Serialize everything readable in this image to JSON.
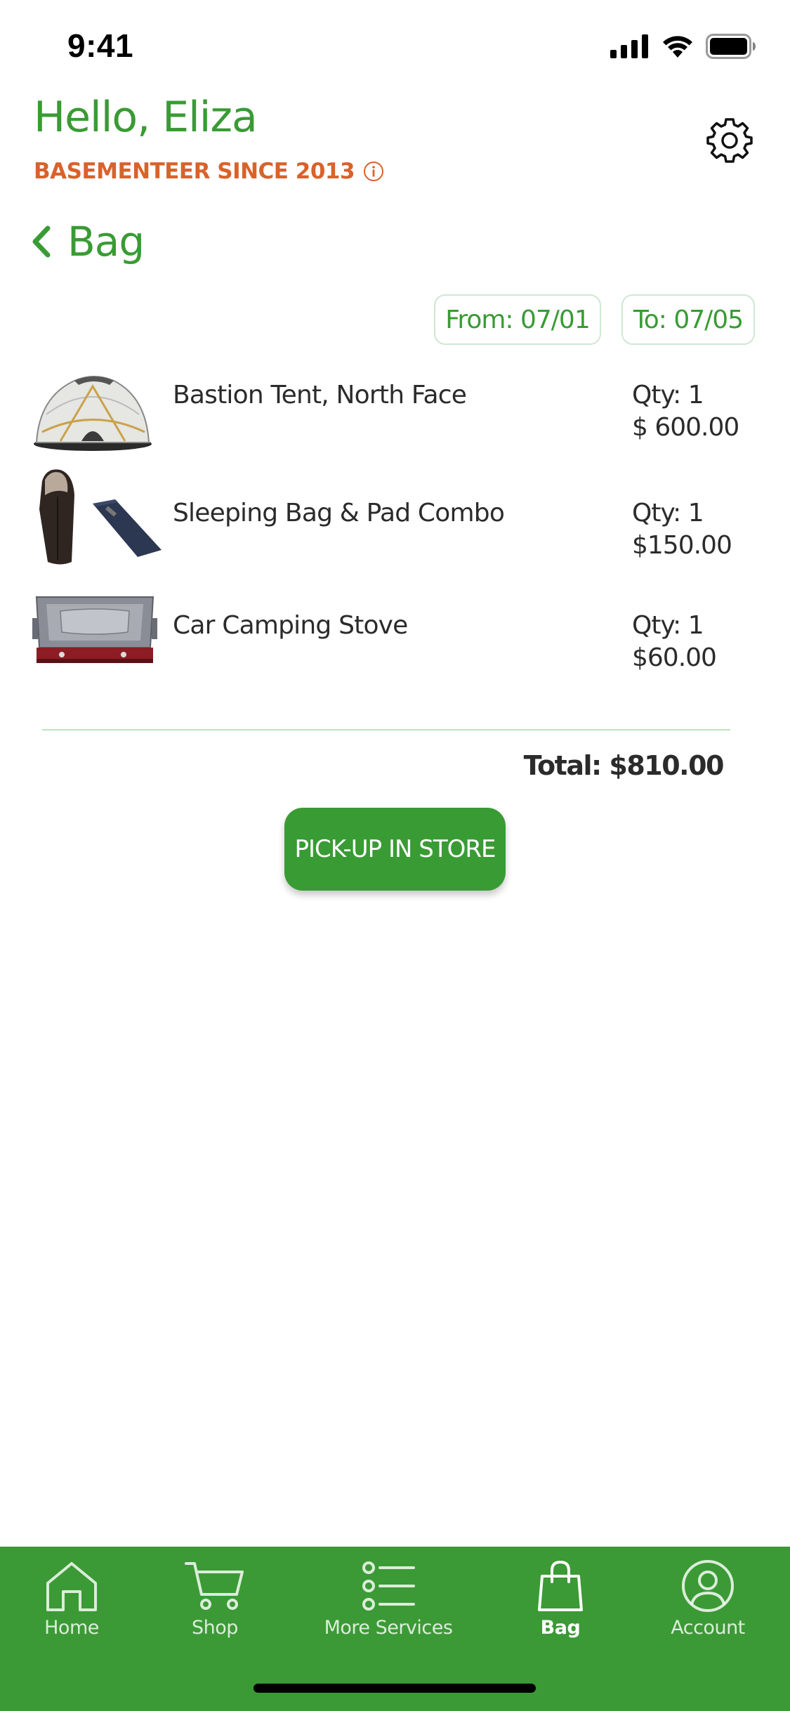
{
  "status_bar": {
    "time": "9:41",
    "icons": [
      "signal-icon",
      "wifi-icon",
      "battery-icon"
    ]
  },
  "header": {
    "greeting": "Hello, Eliza",
    "member_since": "BASEMENTEER SINCE 2013",
    "settings_icon": "gear-icon"
  },
  "page": {
    "title": "Bag",
    "back_icon": "chevron-left-icon"
  },
  "dates": {
    "from": "From: 07/01",
    "to": "To: 07/05"
  },
  "items": [
    {
      "name": "Bastion Tent, North Face",
      "qty": "Qty: 1",
      "price": "$ 600.00",
      "image": "tent-image"
    },
    {
      "name": "Sleeping Bag & Pad Combo",
      "qty": "Qty: 1",
      "price": "$150.00",
      "image": "sleeping-bag-pad-image"
    },
    {
      "name": "Car Camping Stove",
      "qty": "Qty: 1",
      "price": "$60.00",
      "image": "stove-image"
    }
  ],
  "summary": {
    "total": "Total: $810.00",
    "pickup_label": "PICK-UP IN STORE"
  },
  "tabs": [
    {
      "label": "Home",
      "icon": "home-icon",
      "active": false
    },
    {
      "label": "Shop",
      "icon": "cart-icon",
      "active": false
    },
    {
      "label": "More Services",
      "icon": "list-icon",
      "active": false
    },
    {
      "label": "Bag",
      "icon": "bag-icon",
      "active": true
    },
    {
      "label": "Account",
      "icon": "account-icon",
      "active": false
    }
  ],
  "colors": {
    "brand_green": "#399b34",
    "accent_orange": "#d9622b",
    "tab_bar": "#3b9a35"
  }
}
